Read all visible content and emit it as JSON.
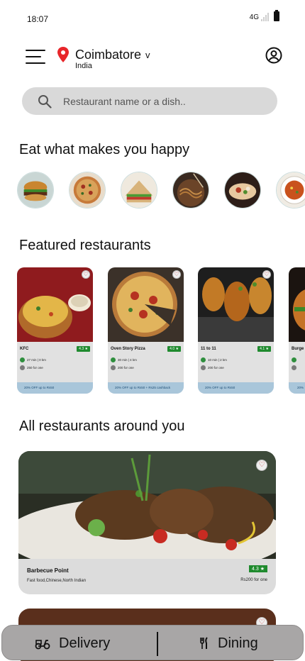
{
  "status_bar": {
    "time": "18:07",
    "network": "4G"
  },
  "header": {
    "city": "Coimbatore",
    "chevron": "v",
    "country": "India",
    "icons": {
      "menu": "hamburger-menu-icon",
      "location": "location-pin-icon",
      "profile": "user-profile-icon"
    },
    "colors": {
      "pin": "#e8262a"
    }
  },
  "search": {
    "placeholder": "Restaurant name or a dish.."
  },
  "categories": {
    "title": "Eat what makes you happy",
    "items": [
      "burger",
      "pizza",
      "sandwich",
      "noodles",
      "wrap",
      "curry"
    ]
  },
  "featured": {
    "title": "Featured restaurants",
    "items": [
      {
        "name": "KFC",
        "rating": "4.3 ★",
        "time_distance": "27 min | 0 km",
        "price": "250 for one",
        "offer": "20% OFF up to Rs50"
      },
      {
        "name": "Oven Story Pizza",
        "rating": "4.0 ★",
        "time_distance": "30 min | 4 km",
        "price": "200 for one",
        "offer": "20% OFF up to Rs50 + Rs25 cashback"
      },
      {
        "name": "11 to 11",
        "rating": "4.1 ★",
        "time_distance": "10 min | 2 km",
        "price": "200 for one",
        "offer": "20% OFF up to Rs50"
      },
      {
        "name": "Burge",
        "rating": "",
        "time_distance": "",
        "price": "",
        "offer": "20%"
      }
    ]
  },
  "all_restaurants": {
    "title": "All restaurants around you",
    "items": [
      {
        "name": "Barbecue Point",
        "cuisines": "Fast food,Chinese,North Indian",
        "rating": "4.3 ★",
        "price": "Rs200 for one"
      }
    ]
  },
  "bottom_nav": {
    "delivery_label": "Delivery",
    "dining_label": "Dining",
    "icons": {
      "delivery": "scooter-icon",
      "dining": "fork-knife-icon"
    }
  },
  "colors": {
    "rating_bg": "#1f8a2e",
    "offer_bg": "#a9c6da",
    "search_bg": "#d9d9d9",
    "nav_bg": "#a8a6a6"
  }
}
